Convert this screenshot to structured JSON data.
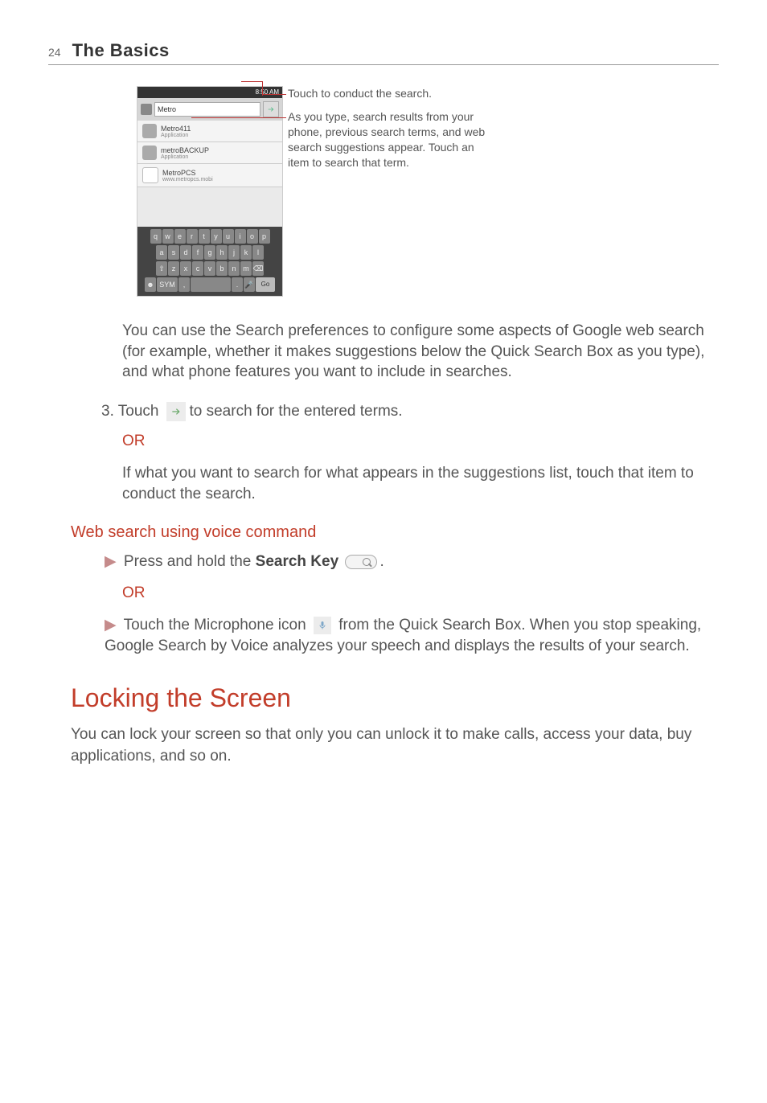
{
  "header": {
    "page_number": "24",
    "section": "The Basics"
  },
  "screenshot": {
    "status_time": "8:50 AM",
    "search_value": "Metro",
    "suggestions": [
      {
        "title": "Metro411",
        "sub": "Application"
      },
      {
        "title": "metroBACKUP",
        "sub": "Application"
      },
      {
        "title": "MetroPCS",
        "sub": "www.metropcs.mobi"
      }
    ],
    "keyboard": {
      "row1": [
        "q",
        "w",
        "e",
        "r",
        "t",
        "y",
        "u",
        "i",
        "o",
        "p"
      ],
      "row2": [
        "a",
        "s",
        "d",
        "f",
        "g",
        "h",
        "j",
        "k",
        "l"
      ],
      "row3_shift": "⇧",
      "row3": [
        "z",
        "x",
        "c",
        "v",
        "b",
        "n",
        "m"
      ],
      "row3_del": "⌫",
      "row4_emoji": "☻",
      "row4_sym": "SYM",
      "row4_comma": ",",
      "row4_period": ".",
      "row4_mic": "🎤",
      "row4_go": "Go"
    }
  },
  "callouts": {
    "c1": "Touch to conduct the search.",
    "c2": "As you type, search results from your phone, previous search terms, and web search suggestions appear. Touch an item to search that term."
  },
  "paragraphs": {
    "p1": "You can use the Search preferences to configure some aspects of Google web search (for example, whether it makes suggestions below the Quick Search Box as you type), and what phone features you want to include in searches.",
    "step3_a": "3. Touch",
    "step3_b": "to search for the entered terms.",
    "or": "OR",
    "p2": "If what you want to search for what appears in the suggestions list, touch that item to conduct the search."
  },
  "voice": {
    "heading": "Web search using voice command",
    "b1_a": "Press and hold the",
    "b1_key": "Search Key",
    "b1_b": ".",
    "or": "OR",
    "b2_a": "Touch the Microphone icon",
    "b2_b": "from the Quick Search Box. When you stop speaking, Google Search by Voice analyzes your speech and displays the results of your search."
  },
  "lock": {
    "heading": "Locking the Screen",
    "para": "You can lock your screen so that only you can unlock it to make calls, access your data, buy applications, and so on."
  }
}
